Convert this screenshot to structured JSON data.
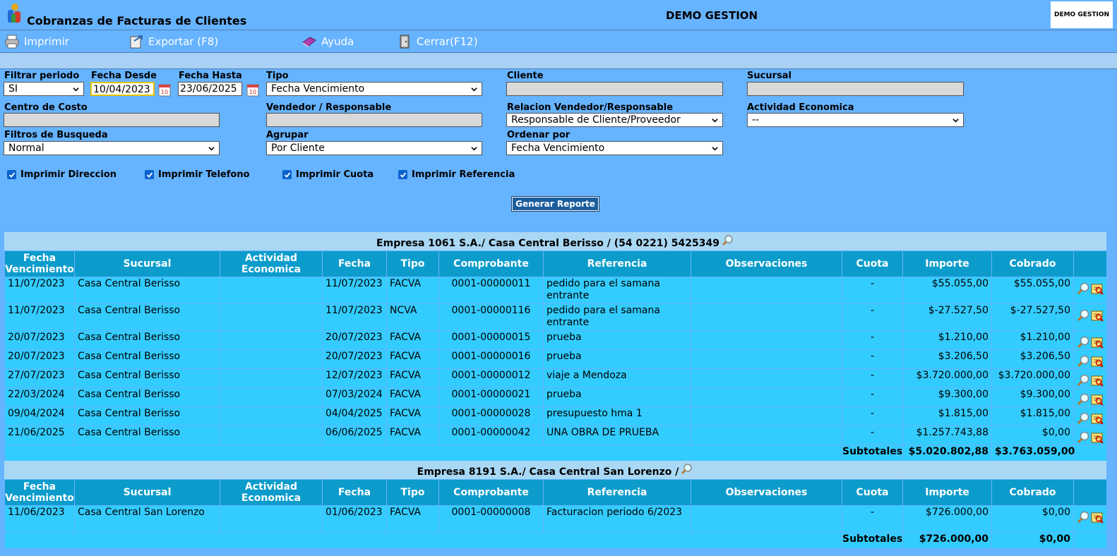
{
  "header": {
    "title": "Cobranzas de Facturas de Clientes",
    "company": "DEMO GESTION",
    "brand_box": "DEMO GESTION"
  },
  "toolbar": {
    "print": "Imprimir",
    "export": "Exportar (F8)",
    "help": "Ayuda",
    "close": "Cerrar(F12)"
  },
  "filters": {
    "filtrar_periodo": {
      "label": "Filtrar periodo",
      "value": "SI"
    },
    "fecha_desde": {
      "label": "Fecha Desde",
      "value": "10/04/2023"
    },
    "fecha_hasta": {
      "label": "Fecha Hasta",
      "value": "23/06/2025"
    },
    "tipo": {
      "label": "Tipo",
      "value": "Fecha Vencimiento"
    },
    "cliente": {
      "label": "Cliente",
      "value": ""
    },
    "sucursal": {
      "label": "Sucursal",
      "value": ""
    },
    "centro_costo": {
      "label": "Centro de Costo",
      "value": ""
    },
    "vendedor": {
      "label": "Vendedor / Responsable",
      "value": ""
    },
    "relacion": {
      "label": "Relacion Vendedor/Responsable",
      "value": "Responsable de Cliente/Proveedor"
    },
    "actividad": {
      "label": "Actividad Economica",
      "value": "--"
    },
    "filtros_busqueda": {
      "label": "Filtros de Busqueda",
      "value": "Normal"
    },
    "agrupar": {
      "label": "Agrupar",
      "value": "Por Cliente"
    },
    "ordenar": {
      "label": "Ordenar por",
      "value": "Fecha Vencimiento"
    }
  },
  "checkboxes": [
    {
      "label": "Imprimir Direccion",
      "checked": true
    },
    {
      "label": "Imprimir Telefono",
      "checked": true
    },
    {
      "label": "Imprimir Cuota",
      "checked": true
    },
    {
      "label": "Imprimir Referencia",
      "checked": true
    }
  ],
  "generate_label": "Generar Reporte",
  "columns": {
    "fecha_venc_1": "Fecha",
    "fecha_venc_2": "Vencimiento",
    "sucursal": "Sucursal",
    "actividad_1": "Actividad",
    "actividad_2": "Economica",
    "fecha": "Fecha",
    "tipo": "Tipo",
    "comprobante": "Comprobante",
    "referencia": "Referencia",
    "observaciones": "Observaciones",
    "cuota": "Cuota",
    "importe": "Importe",
    "cobrado": "Cobrado"
  },
  "groups": [
    {
      "title": "Empresa 1061 S.A./ Casa Central Berisso / (54 0221) 5425349",
      "rows": [
        {
          "venc": "11/07/2023",
          "sucursal": "Casa Central Berisso",
          "actividad": "",
          "fecha": "11/07/2023",
          "tipo": "FACVA",
          "comprobante": "0001-00000011",
          "referencia": "pedido para el samana entrante",
          "observaciones": "",
          "cuota": "-",
          "importe": "$55.055,00",
          "cobrado": "$55.055,00"
        },
        {
          "venc": "11/07/2023",
          "sucursal": "Casa Central Berisso",
          "actividad": "",
          "fecha": "11/07/2023",
          "tipo": "NCVA",
          "comprobante": "0001-00000116",
          "referencia": "pedido para el samana entrante",
          "observaciones": "",
          "cuota": "-",
          "importe": "$-27.527,50",
          "cobrado": "$-27.527,50"
        },
        {
          "venc": "20/07/2023",
          "sucursal": "Casa Central Berisso",
          "actividad": "",
          "fecha": "20/07/2023",
          "tipo": "FACVA",
          "comprobante": "0001-00000015",
          "referencia": "prueba",
          "observaciones": "",
          "cuota": "-",
          "importe": "$1.210,00",
          "cobrado": "$1.210,00"
        },
        {
          "venc": "20/07/2023",
          "sucursal": "Casa Central Berisso",
          "actividad": "",
          "fecha": "20/07/2023",
          "tipo": "FACVA",
          "comprobante": "0001-00000016",
          "referencia": "prueba",
          "observaciones": "",
          "cuota": "-",
          "importe": "$3.206,50",
          "cobrado": "$3.206,50"
        },
        {
          "venc": "27/07/2023",
          "sucursal": "Casa Central Berisso",
          "actividad": "",
          "fecha": "12/07/2023",
          "tipo": "FACVA",
          "comprobante": "0001-00000012",
          "referencia": "viaje a Mendoza",
          "observaciones": "",
          "cuota": "-",
          "importe": "$3.720.000,00",
          "cobrado": "$3.720.000,00"
        },
        {
          "venc": "22/03/2024",
          "sucursal": "Casa Central Berisso",
          "actividad": "",
          "fecha": "07/03/2024",
          "tipo": "FACVA",
          "comprobante": "0001-00000021",
          "referencia": "prueba",
          "observaciones": "",
          "cuota": "-",
          "importe": "$9.300,00",
          "cobrado": "$9.300,00"
        },
        {
          "venc": "09/04/2024",
          "sucursal": "Casa Central Berisso",
          "actividad": "",
          "fecha": "04/04/2025",
          "tipo": "FACVA",
          "comprobante": "0001-00000028",
          "referencia": "presupuesto hma 1",
          "observaciones": "",
          "cuota": "-",
          "importe": "$1.815,00",
          "cobrado": "$1.815,00"
        },
        {
          "venc": "21/06/2025",
          "sucursal": "Casa Central Berisso",
          "actividad": "",
          "fecha": "06/06/2025",
          "tipo": "FACVA",
          "comprobante": "0001-00000042",
          "referencia": "UNA OBRA DE PRUEBA",
          "observaciones": "",
          "cuota": "-",
          "importe": "$1.257.743,88",
          "cobrado": "$0,00"
        }
      ],
      "subtotal_label": "Subtotales",
      "subtotal_importe": "$5.020.802,88",
      "subtotal_cobrado": "$3.763.059,00"
    },
    {
      "title": "Empresa 8191 S.A./ Casa Central San Lorenzo /",
      "rows": [
        {
          "venc": "11/06/2023",
          "sucursal": "Casa Central San Lorenzo",
          "actividad": "",
          "fecha": "01/06/2023",
          "tipo": "FACVA",
          "comprobante": "0001-00000008",
          "referencia": "Facturacion periodo 6/2023",
          "observaciones": "",
          "cuota": "-",
          "importe": "$726.000,00",
          "cobrado": "$0,00"
        }
      ],
      "subtotal_label": "Subtotales",
      "subtotal_importe": "$726.000,00",
      "subtotal_cobrado": "$0,00"
    }
  ],
  "colors": {
    "background": "#66b3ff",
    "header_cell": "#0c9ccc",
    "row_cell": "#33ccff",
    "group_head": "#a9d8f5",
    "button": "#1a5e9e"
  }
}
